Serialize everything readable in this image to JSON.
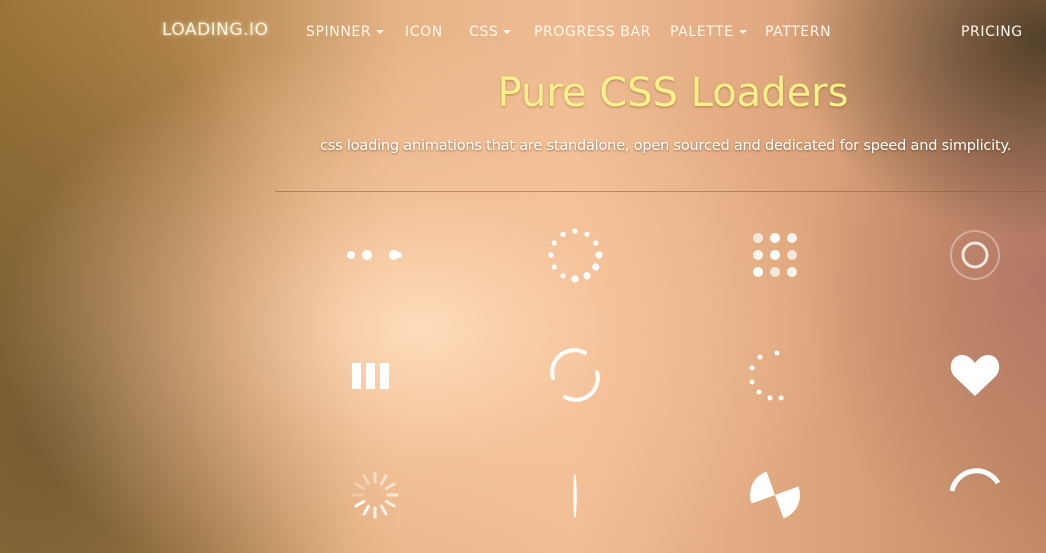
{
  "nav": {
    "brand": "LOADING.IO",
    "items": [
      {
        "label": "SPINNER",
        "dropdown": true
      },
      {
        "label": "ICON",
        "dropdown": false
      },
      {
        "label": "CSS",
        "dropdown": true
      },
      {
        "label": "PROGRESS BAR",
        "dropdown": false
      },
      {
        "label": "PALETTE",
        "dropdown": true
      },
      {
        "label": "PATTERN",
        "dropdown": false
      }
    ],
    "pricing": "PRICING"
  },
  "hero": {
    "title": "Pure CSS Loaders",
    "subtitle": "css loading animations that are standalone, open sourced and dedicated for speed and simplicity."
  },
  "loaders": [
    {
      "name": "ellipsis"
    },
    {
      "name": "default"
    },
    {
      "name": "grid"
    },
    {
      "name": "ripple"
    },
    {
      "name": "facebook"
    },
    {
      "name": "dual-ring"
    },
    {
      "name": "roller"
    },
    {
      "name": "heart"
    },
    {
      "name": "spinner"
    },
    {
      "name": "hourglass-line"
    },
    {
      "name": "hourglass"
    },
    {
      "name": "ring"
    }
  ],
  "colors": {
    "title": "#fbf08a",
    "loader": "#ffffff"
  }
}
